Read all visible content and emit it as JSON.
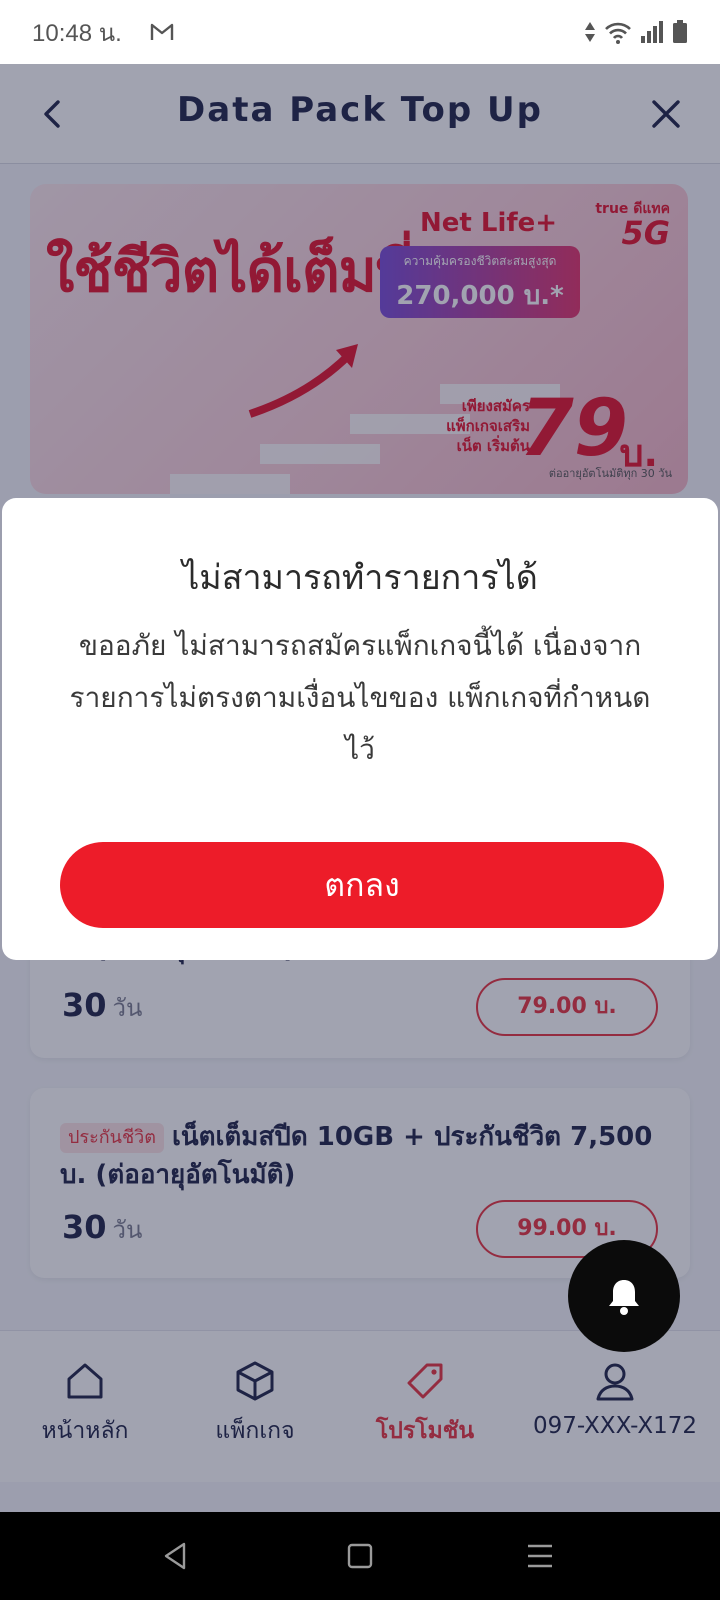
{
  "status_bar": {
    "time": "10:48 น."
  },
  "header": {
    "title": "Data Pack Top Up"
  },
  "banner": {
    "headline": "ใช้ชีวิตได้เต็มที่",
    "brand": "true ดีแทค",
    "network": "5G",
    "product": "Net Life+",
    "prize_caption": "ความคุ้มครองชีวิตสะสมสูงสุด",
    "prize_amount": "270,000 บ.*",
    "apply_text": "เพียงสมัคร แพ็กเกจเสริมเน็ต เริ่มต้น",
    "price": "79",
    "price_unit": "บ.",
    "renewal_note": "ต่ออายุอัตโนมัติทุก 30 วัน"
  },
  "packages": [
    {
      "title": "บ. (ต่ออายุอัตโนมัติ)",
      "days": "30",
      "days_unit": "วัน",
      "price": "79.00 บ."
    },
    {
      "tag": "ประกันชีวิต",
      "title": "เน็ตเต็มสปีด 10GB + ประกันชีวิต 7,500 บ. (ต่ออายุอัตโนมัติ)",
      "days": "30",
      "days_unit": "วัน",
      "price": "99.00 บ."
    }
  ],
  "dialog": {
    "title": "ไม่สามารถทำรายการได้",
    "message": "ขออภัย ไม่สามารถสมัครแพ็กเกจนี้ได้ เนื่องจากรายการไม่ตรงตามเงื่อนไขของ แพ็กเกจที่กำหนดไว้",
    "ok_label": "ตกลง"
  },
  "bottom_nav": {
    "items": [
      {
        "label": "หน้าหลัก",
        "icon": "home-icon"
      },
      {
        "label": "แพ็กเกจ",
        "icon": "package-box-icon"
      },
      {
        "label": "โปรโมชัน",
        "icon": "price-tag-icon",
        "active": true
      },
      {
        "label": "097-XXX-X172",
        "icon": "user-icon"
      }
    ]
  },
  "colors": {
    "accent": "#ed1c29",
    "text_dark": "#1e2347",
    "overlay": "#1e2442"
  }
}
